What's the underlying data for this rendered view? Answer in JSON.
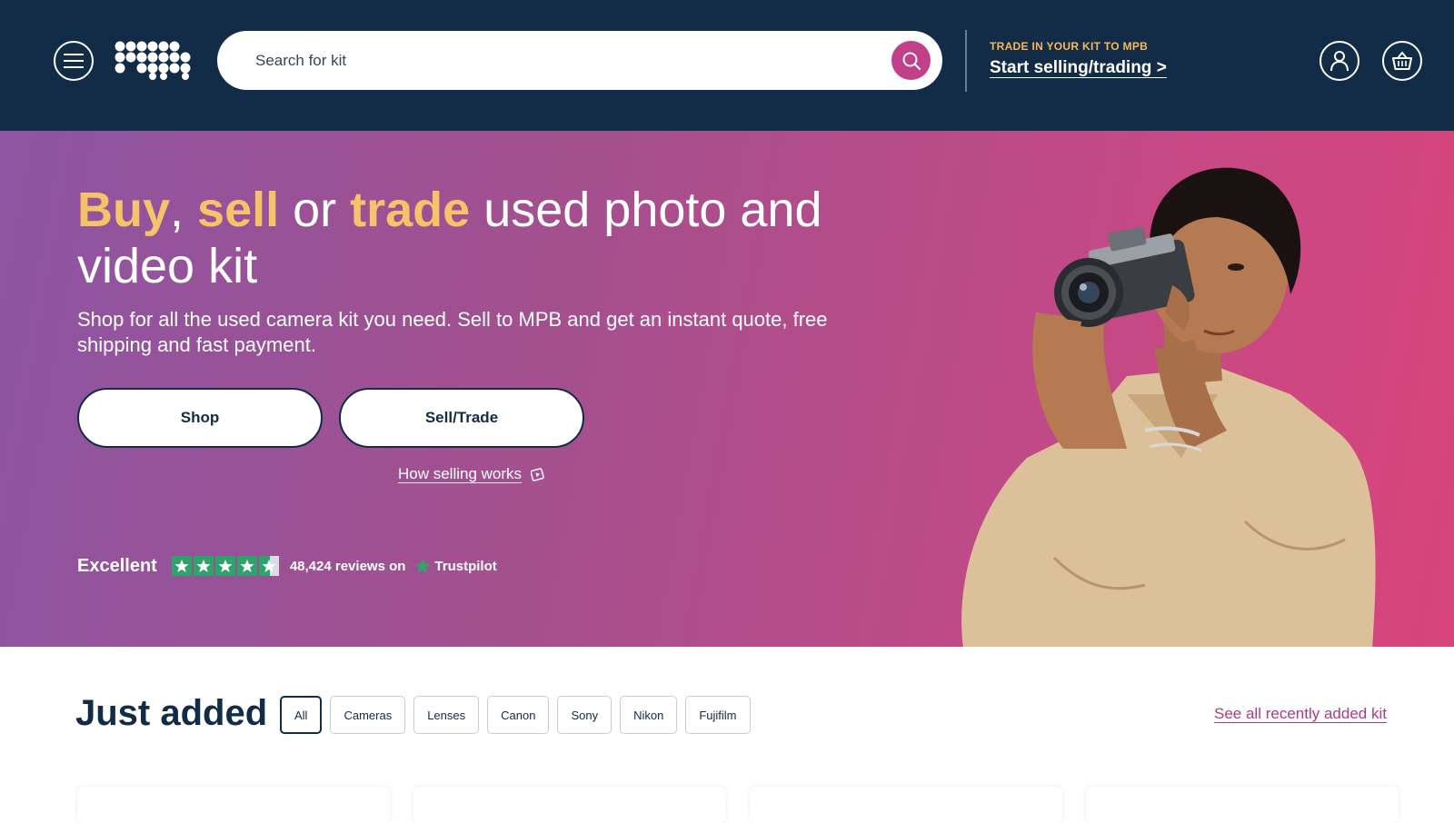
{
  "header": {
    "search_placeholder": "Search for kit",
    "trade_kicker": "TRADE IN YOUR KIT TO MPB",
    "trade_link": "Start selling/trading >"
  },
  "hero": {
    "title_buy": "Buy",
    "title_comma": ", ",
    "title_sell": "sell",
    "title_or": " or ",
    "title_trade": "trade",
    "title_rest": " used photo and video kit",
    "subtitle": "Shop for all the used camera kit you need. Sell to MPB and get an instant quote, free shipping and fast payment.",
    "shop_button": "Shop",
    "sell_button": "Sell/Trade",
    "how_link": "How selling works"
  },
  "trustpilot": {
    "rating_text": "Excellent",
    "stars": 4.5,
    "review_count_text": "48,424 reviews on",
    "brand": "Trustpilot"
  },
  "just_added": {
    "title": "Just added",
    "filters": [
      "All",
      "Cameras",
      "Lenses",
      "Canon",
      "Sony",
      "Nikon",
      "Fujifilm"
    ],
    "active_filter": "All",
    "see_all": "See all recently added kit"
  },
  "colors": {
    "navy": "#122b47",
    "accent_yellow": "#f6c36a",
    "accent_pink": "#c23f8a",
    "trustpilot_green": "#2ea36b"
  }
}
